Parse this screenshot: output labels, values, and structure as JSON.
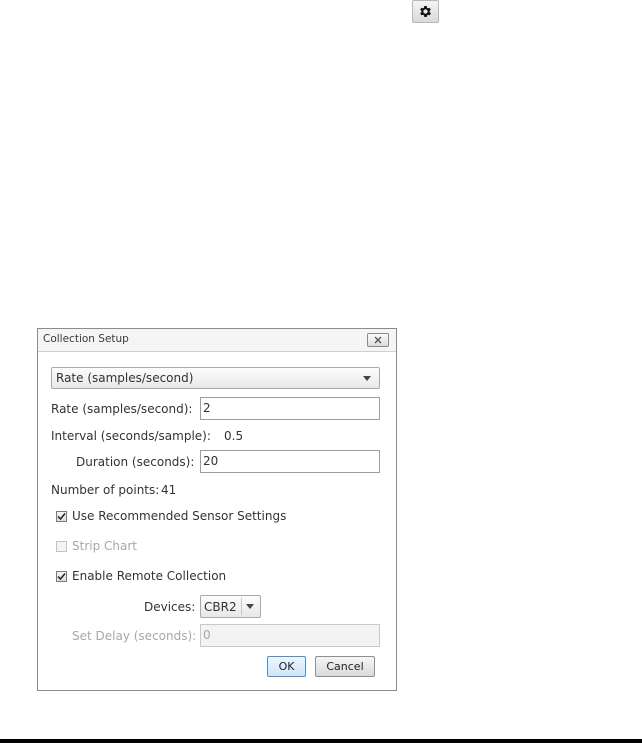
{
  "toolbar": {
    "gear_icon": "gear-icon"
  },
  "dialog": {
    "title": "Collection Setup",
    "close_icon": "close-icon",
    "mode_select": {
      "value": "Rate (samples/second)"
    },
    "rate": {
      "label": "Rate (samples/second):",
      "value": "2"
    },
    "interval": {
      "label": "Interval (seconds/sample):",
      "value": "0.5"
    },
    "duration": {
      "label": "Duration (seconds):",
      "value": "20"
    },
    "points": {
      "label": "Number of points:",
      "value": "41"
    },
    "use_recommended": {
      "label": "Use Recommended Sensor Settings",
      "checked": true
    },
    "strip_chart": {
      "label": "Strip Chart",
      "checked": false,
      "disabled": true
    },
    "enable_remote": {
      "label": "Enable Remote Collection",
      "checked": true
    },
    "devices": {
      "label": "Devices:",
      "value": "CBR2"
    },
    "set_delay": {
      "label": "Set Delay (seconds):",
      "value": "0",
      "disabled": true
    },
    "buttons": {
      "ok_label": "OK",
      "cancel_label": "Cancel"
    }
  },
  "colors": {
    "ok_border": "#4d8fd0",
    "disabled_text": "#a8a8a8"
  }
}
